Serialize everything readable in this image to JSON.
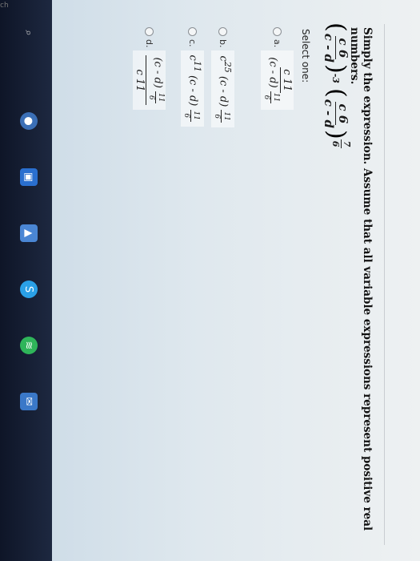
{
  "corner_label": "ch",
  "question": {
    "text": "Simply the expression. Assume that all variable expressions represent positive real numbers."
  },
  "expression": {
    "f1_num": "c 6",
    "f1_den": "c - d",
    "exp1": "-3",
    "f2_num": "c 6",
    "f2_den": "c - d",
    "exp2_num": "7",
    "exp2_den": "6"
  },
  "select_one": "Select one:",
  "options": [
    {
      "letter": "a.",
      "num": "c 11",
      "den_base": "(c - d)",
      "den_exp_num": "11",
      "den_exp_den": "6"
    },
    {
      "letter": "b.",
      "coef": "c",
      "coef_exp": "25",
      "base": "(c - d)",
      "exp_num": "11",
      "exp_den": "6"
    },
    {
      "letter": "c.",
      "coef": "c",
      "coef_exp": "11",
      "base": "(c - d)",
      "exp_num": "11",
      "exp_den": "6"
    },
    {
      "letter": "d.",
      "num_base": "(c - d)",
      "num_exp_num": "11",
      "num_exp_den": "6",
      "den": "c 11"
    }
  ],
  "taskbar": {
    "icons": [
      "search-icon",
      "chrome-icon",
      "store-icon",
      "photos-icon",
      "skype-icon",
      "spotify-icon",
      "mail-icon"
    ],
    "accent": "#1d2840"
  }
}
